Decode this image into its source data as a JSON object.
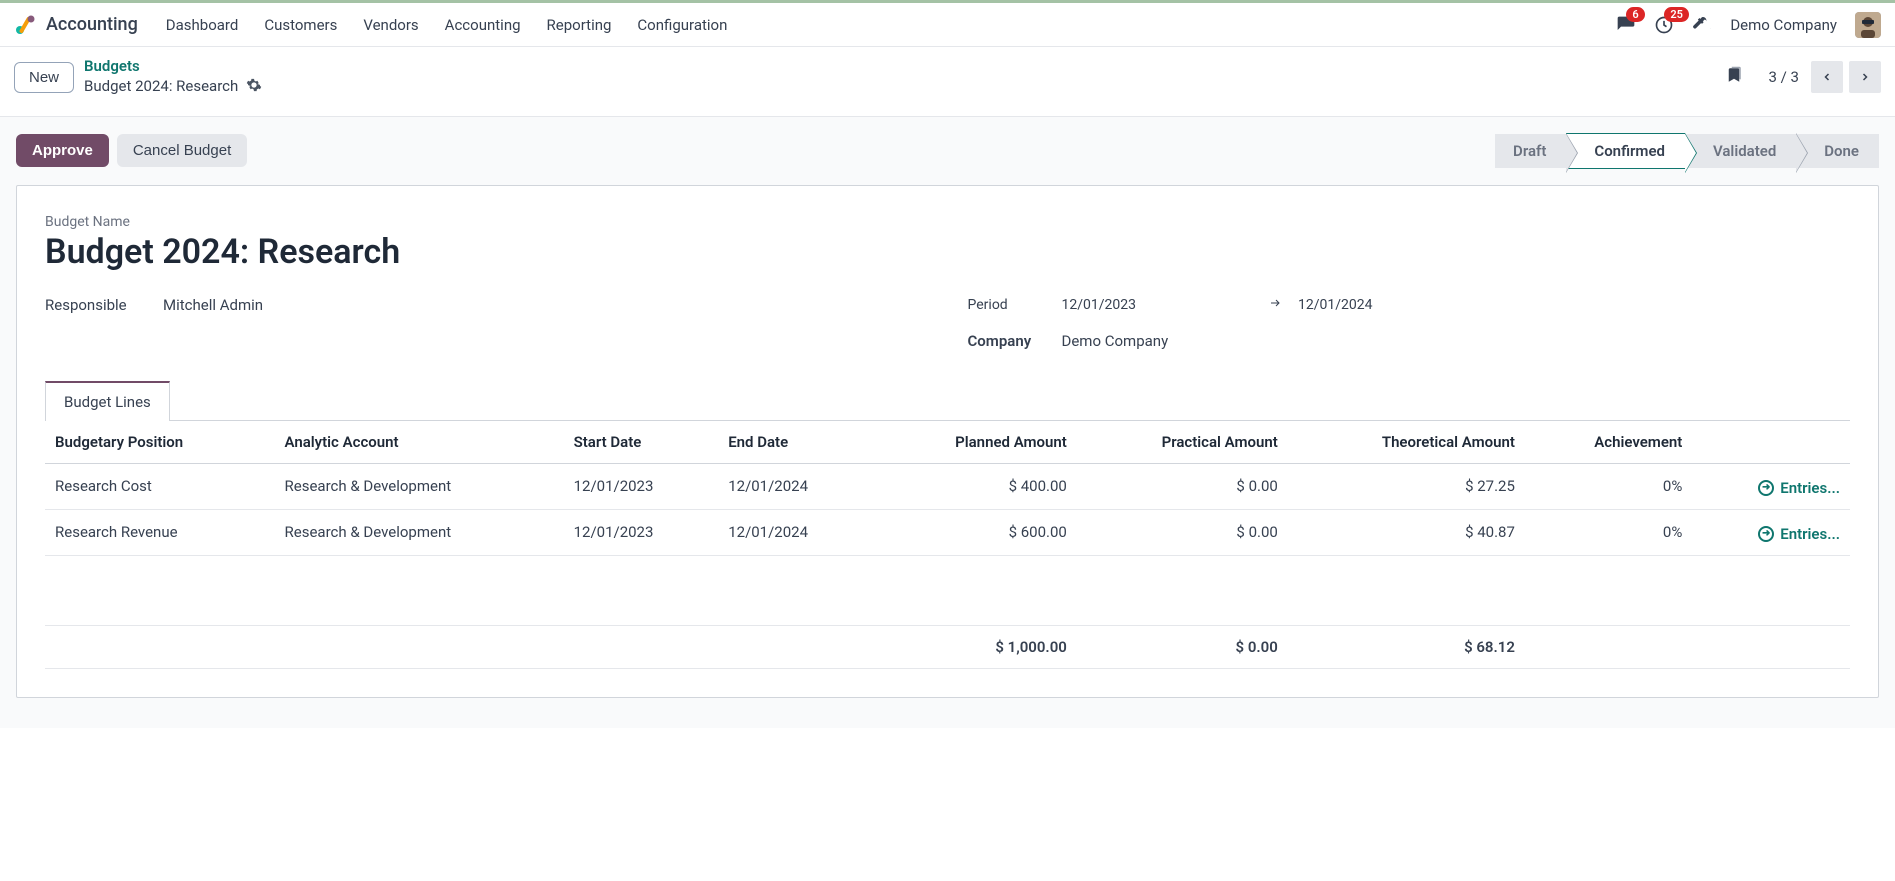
{
  "app": {
    "name": "Accounting"
  },
  "nav": {
    "items": [
      "Dashboard",
      "Customers",
      "Vendors",
      "Accounting",
      "Reporting",
      "Configuration"
    ]
  },
  "header": {
    "messages_badge": "6",
    "activities_badge": "25",
    "company": "Demo Company"
  },
  "control": {
    "new_label": "New",
    "breadcrumb_parent": "Budgets",
    "breadcrumb_current": "Budget 2024: Research",
    "pager": "3 / 3"
  },
  "actions": {
    "approve": "Approve",
    "cancel": "Cancel Budget"
  },
  "status": {
    "steps": [
      "Draft",
      "Confirmed",
      "Validated",
      "Done"
    ],
    "active_index": 1
  },
  "form": {
    "name_label": "Budget Name",
    "name": "Budget 2024: Research",
    "responsible_label": "Responsible",
    "responsible": "Mitchell Admin",
    "period_label": "Period",
    "period_from": "12/01/2023",
    "period_to": "12/01/2024",
    "company_label": "Company",
    "company": "Demo Company"
  },
  "tabs": {
    "lines": "Budget Lines"
  },
  "table": {
    "columns": {
      "position": "Budgetary Position",
      "analytic": "Analytic Account",
      "start": "Start Date",
      "end": "End Date",
      "planned": "Planned Amount",
      "practical": "Practical Amount",
      "theoretical": "Theoretical Amount",
      "achievement": "Achievement"
    },
    "rows": [
      {
        "position": "Research Cost",
        "analytic": "Research & Development",
        "start": "12/01/2023",
        "end": "12/01/2024",
        "planned": "$ 400.00",
        "practical": "$ 0.00",
        "theoretical": "$ 27.25",
        "achievement": "0%",
        "entries": "Entries..."
      },
      {
        "position": "Research Revenue",
        "analytic": "Research & Development",
        "start": "12/01/2023",
        "end": "12/01/2024",
        "planned": "$ 600.00",
        "practical": "$ 0.00",
        "theoretical": "$ 40.87",
        "achievement": "0%",
        "entries": "Entries..."
      }
    ],
    "totals": {
      "planned": "$ 1,000.00",
      "practical": "$ 0.00",
      "theoretical": "$ 68.12"
    }
  }
}
